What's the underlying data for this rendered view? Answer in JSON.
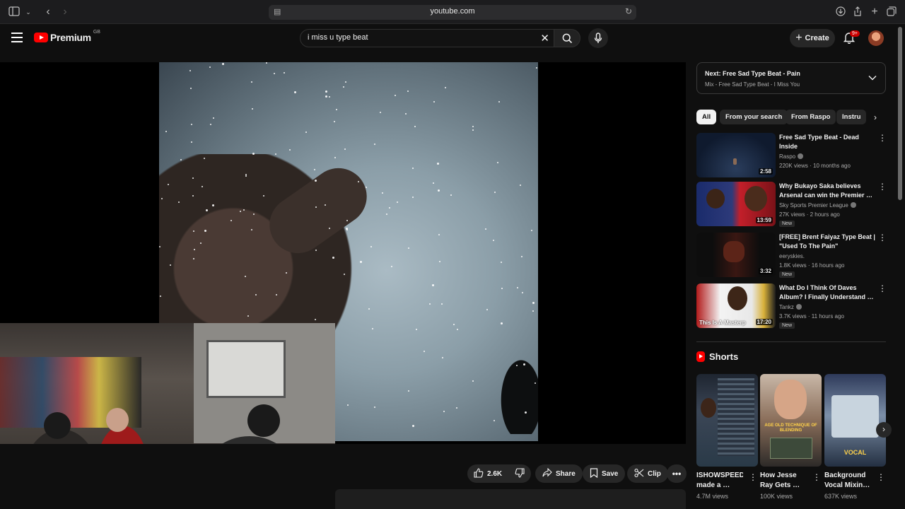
{
  "browser": {
    "url": "youtube.com",
    "sidebar_icon": "sidebar-toggle-icon",
    "icons": [
      "back-icon",
      "forward-icon",
      "reload-icon",
      "download-icon",
      "share-icon",
      "new-tab-icon",
      "tabs-overview-icon"
    ]
  },
  "header": {
    "logo_text": "Premium",
    "country": "GB",
    "search_query": "i miss u type beat",
    "create_label": "Create",
    "notifications_badge": "9+"
  },
  "actions": {
    "like_count": "2.6K",
    "share_label": "Share",
    "save_label": "Save",
    "clip_label": "Clip"
  },
  "up_next": {
    "prefix": "Next:",
    "title": "Free Sad Type Beat - Pain",
    "subtitle": "Mix - Free Sad Type Beat - I Miss You"
  },
  "chips": [
    "All",
    "From your search",
    "From Raspo",
    "Instru"
  ],
  "recommendations": [
    {
      "title": "Free Sad Type Beat - Dead Inside",
      "channel": "Raspo",
      "verified": true,
      "views": "220K views",
      "age": "10 months ago",
      "duration": "2:58",
      "badge": ""
    },
    {
      "title": "Why Bukayo Saka believes Arsenal can win the Premier …",
      "channel": "Sky Sports Premier League",
      "verified": true,
      "views": "27K views",
      "age": "2 hours ago",
      "duration": "13:59",
      "badge": "New"
    },
    {
      "title": "[FREE] Brent Faiyaz Type Beat | \"Used To The Pain\"",
      "channel": "eeryskies.",
      "verified": false,
      "views": "1.8K views",
      "age": "16 hours ago",
      "duration": "3:32",
      "badge": "New"
    },
    {
      "title": "What Do I Think Of Daves Album? I Finally Understand …",
      "channel": "Tankz",
      "verified": true,
      "views": "3.7K views",
      "age": "11 hours ago",
      "duration": "17:20",
      "badge": "New",
      "thumb_text": "This Is A Masterp"
    }
  ],
  "shorts": {
    "heading": "Shorts",
    "items": [
      {
        "title": "ISHOWSPEED made a …",
        "views": "4.7M views"
      },
      {
        "title": "How Jesse Ray Gets …",
        "views": "100K views",
        "thumb_text": "AGE OLD TECHNIQUE OF BLENDING"
      },
      {
        "title": "Background Vocal Mixin…",
        "views": "637K views",
        "thumb_text": "VOCAL"
      }
    ]
  },
  "colors": {
    "background": "#0f0f0f",
    "brand_red": "#ff0000",
    "chip_bg": "#272727",
    "text_secondary": "#aaaaaa"
  }
}
